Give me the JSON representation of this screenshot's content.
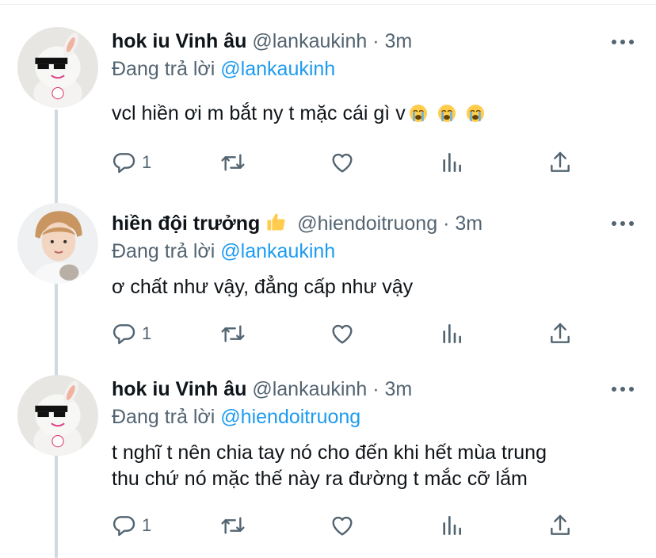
{
  "icons": {
    "reply": "reply-icon",
    "retweet": "retweet-icon",
    "like": "heart-icon",
    "views": "analytics-icon",
    "share": "share-icon",
    "more": "more-icon"
  },
  "colors": {
    "mention": "#1d9bf0",
    "muted": "#536471",
    "thread_line": "#cfd9de"
  },
  "tweets": [
    {
      "name": "hok iu Vinh âu",
      "handle": "@lankaukinh",
      "time": "· 3m",
      "replying_prefix": "Đang trả lời",
      "replying_to": "@lankaukinh",
      "text": "vcl hiền ơi m bắt ny t mặc cái gì v",
      "reply_count": "1"
    },
    {
      "name": "hiền đội trưởng",
      "handle": "@hiendoitruong",
      "time": "· 3m",
      "replying_prefix": "Đang trả lời",
      "replying_to": "@lankaukinh",
      "text": "ơ chất như vậy, đẳng cấp như vậy",
      "reply_count": "1"
    },
    {
      "name": "hok iu Vinh âu",
      "handle": "@lankaukinh",
      "time": "· 3m",
      "replying_prefix": "Đang trả lời",
      "replying_to": "@hiendoitruong",
      "text_line1": "t nghĩ t nên chia tay nó cho đến khi hết mùa trung",
      "text_line2": "thu chứ nó mặc thế này ra đường t mắc cỡ lắm",
      "reply_count": "1"
    }
  ]
}
